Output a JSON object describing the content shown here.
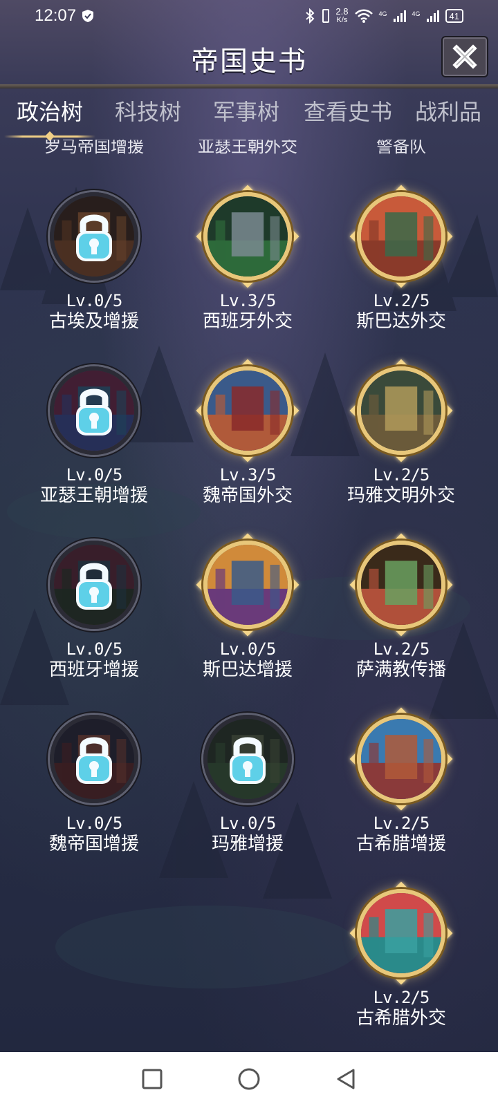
{
  "status_bar": {
    "time": "12:07",
    "net_speed_top": "2.8",
    "net_speed_unit": "K/s",
    "signal1": "4G",
    "signal2": "4G",
    "battery": "41"
  },
  "header": {
    "title": "帝国史书",
    "close_icon": "close-icon"
  },
  "tabs": [
    {
      "label": "政治树",
      "active": true
    },
    {
      "label": "科技树",
      "active": false
    },
    {
      "label": "军事树",
      "active": false
    },
    {
      "label": "查看史书",
      "active": false
    },
    {
      "label": "战利品",
      "active": false
    }
  ],
  "column_headers": [
    "罗马帝国增援",
    "亚瑟王朝外交",
    "警备队"
  ],
  "nodes": [
    {
      "level": "Lv.0/5",
      "name": "古埃及增援",
      "locked": true
    },
    {
      "level": "Lv.3/5",
      "name": "西班牙外交",
      "locked": false
    },
    {
      "level": "Lv.2/5",
      "name": "斯巴达外交",
      "locked": false
    },
    {
      "level": "Lv.0/5",
      "name": "亚瑟王朝增援",
      "locked": true
    },
    {
      "level": "Lv.3/5",
      "name": "魏帝国外交",
      "locked": false
    },
    {
      "level": "Lv.2/5",
      "name": "玛雅文明外交",
      "locked": false
    },
    {
      "level": "Lv.0/5",
      "name": "西班牙增援",
      "locked": true
    },
    {
      "level": "Lv.0/5",
      "name": "斯巴达增援",
      "locked": false
    },
    {
      "level": "Lv.2/5",
      "name": "萨满教传播",
      "locked": false
    },
    {
      "level": "Lv.0/5",
      "name": "魏帝国增援",
      "locked": true
    },
    {
      "level": "Lv.0/5",
      "name": "玛雅增援",
      "locked": true
    },
    {
      "level": "Lv.2/5",
      "name": "古希腊增援",
      "locked": false
    },
    {
      "level": "Lv.2/5",
      "name": "古希腊外交",
      "locked": false
    }
  ],
  "colors": {
    "gold_ring": "#e8c77a",
    "lock_blue": "#5ed0e8",
    "background": "#262a45"
  }
}
